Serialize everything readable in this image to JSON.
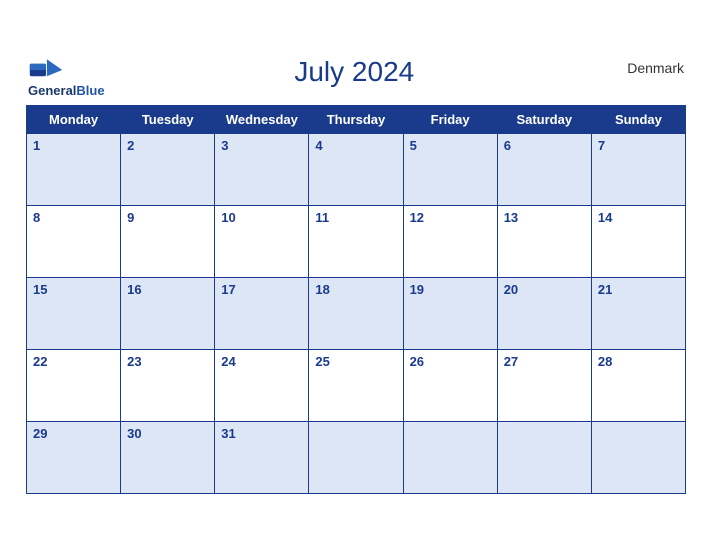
{
  "header": {
    "logo_line1": "General",
    "logo_line2": "Blue",
    "month_title": "July 2024",
    "country": "Denmark"
  },
  "days_of_week": [
    "Monday",
    "Tuesday",
    "Wednesday",
    "Thursday",
    "Friday",
    "Saturday",
    "Sunday"
  ],
  "weeks": [
    [
      1,
      2,
      3,
      4,
      5,
      6,
      7
    ],
    [
      8,
      9,
      10,
      11,
      12,
      13,
      14
    ],
    [
      15,
      16,
      17,
      18,
      19,
      20,
      21
    ],
    [
      22,
      23,
      24,
      25,
      26,
      27,
      28
    ],
    [
      29,
      30,
      31,
      null,
      null,
      null,
      null
    ]
  ]
}
